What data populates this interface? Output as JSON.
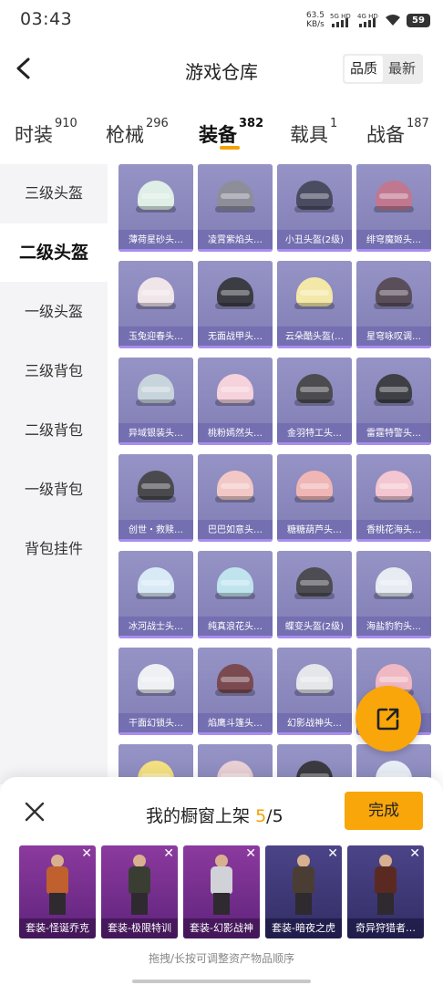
{
  "status_bar": {
    "time": "03:43",
    "net_speed_value": "63.5",
    "net_speed_unit": "KB/s",
    "sig1": "5G HD",
    "sig2": "4G HD",
    "battery": "59"
  },
  "header": {
    "title": "游戏仓库",
    "sort_options": [
      "品质",
      "最新"
    ],
    "sort_active": "品质"
  },
  "main_tabs": [
    {
      "label": "时装",
      "count": "910"
    },
    {
      "label": "枪械",
      "count": "296"
    },
    {
      "label": "装备",
      "count": "382"
    },
    {
      "label": "载具",
      "count": "1"
    },
    {
      "label": "战备",
      "count": "187"
    }
  ],
  "active_tab": "装备",
  "sidebar": [
    "三级头盔",
    "二级头盔",
    "一级头盔",
    "三级背包",
    "二级背包",
    "一级背包",
    "背包挂件"
  ],
  "active_sidebar": "二级头盔",
  "items": [
    {
      "name": "薄荷星砂头…",
      "color": "#dfeee6"
    },
    {
      "name": "凌霄紫焰头…",
      "color": "#8e8e9a"
    },
    {
      "name": "小丑头盔(2级)",
      "color": "#4a4c62"
    },
    {
      "name": "绯穹魔姬头…",
      "color": "#c07890"
    },
    {
      "name": "玉兔迎春头…",
      "color": "#f0e6ea"
    },
    {
      "name": "无面战甲头…",
      "color": "#3c3c44"
    },
    {
      "name": "云朵酷头盔(…",
      "color": "#f4e8a8"
    },
    {
      "name": "星穹咏叹调…",
      "color": "#5a4e5a"
    },
    {
      "name": "异域银装头…",
      "color": "#c8d4dc"
    },
    {
      "name": "桃粉嫣然头…",
      "color": "#f6d2dc"
    },
    {
      "name": "金羽特工头…",
      "color": "#4c4c50"
    },
    {
      "name": "雷霆特警头…",
      "color": "#3e4046"
    },
    {
      "name": "创世・救赎…",
      "color": "#4a4a4e"
    },
    {
      "name": "巴巴如意头…",
      "color": "#f2c8c6"
    },
    {
      "name": "糖糖葫芦头…",
      "color": "#f0b6b6"
    },
    {
      "name": "香桃花海头…",
      "color": "#f4c6d2"
    },
    {
      "name": "冰河战士头…",
      "color": "#d8eaf6"
    },
    {
      "name": "纯真浪花头…",
      "color": "#bfe4ee"
    },
    {
      "name": "蝶变头盔(2级)",
      "color": "#4c4c52"
    },
    {
      "name": "海盐豹豹头…",
      "color": "#e6ecf2"
    },
    {
      "name": "干面幻锁头…",
      "color": "#eef0f4"
    },
    {
      "name": "焰鹰斗篷头…",
      "color": "#7a4a50"
    },
    {
      "name": "幻影战神头…",
      "color": "#e4e6ea"
    },
    {
      "name": "",
      "color": "#f0b8c2"
    },
    {
      "name": "",
      "color": "#f4e080"
    },
    {
      "name": "",
      "color": "#e8d0d4"
    },
    {
      "name": "",
      "color": "#3a3a40"
    },
    {
      "name": "",
      "color": "#e8eef6"
    }
  ],
  "showcase": {
    "title_prefix": "我的橱窗上架",
    "current": "5",
    "separator": "/",
    "max": "5",
    "done_label": "完成",
    "slots": [
      {
        "label": "套装-怪诞乔克",
        "tone": "purple",
        "body_color": "#c0602e"
      },
      {
        "label": "套装-极限特训",
        "tone": "purple",
        "body_color": "#3a3e32"
      },
      {
        "label": "套装-幻影战神",
        "tone": "purple",
        "body_color": "#d0d2d8"
      },
      {
        "label": "套装-暗夜之虎",
        "tone": "navy",
        "body_color": "#4a3e34"
      },
      {
        "label": "奇异狩猎者…",
        "tone": "navy",
        "body_color": "#5a2a22"
      }
    ],
    "hint": "拖拽/长按可调整资产物品顺序"
  }
}
